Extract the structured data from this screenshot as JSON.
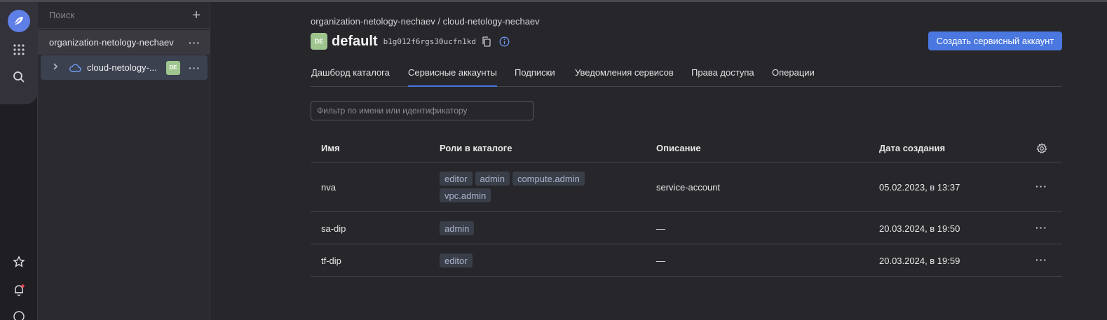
{
  "sidebar": {
    "search_placeholder": "Поиск",
    "add_icon": "plus-icon",
    "organization": "organization-netology-nechaev",
    "cloud": {
      "label": "cloud-netology-...",
      "badge": "DE"
    },
    "menu_glyph": "···"
  },
  "header": {
    "breadcrumb": "organization-netology-nechaev / cloud-netology-nechaev",
    "badge": "DE",
    "title": "default",
    "folder_id": "b1g012f6rgs30ucfn1kd",
    "create_button": "Создать сервисный аккаунт"
  },
  "tabs": [
    {
      "label": "Дашборд каталога"
    },
    {
      "label": "Сервисные аккаунты",
      "active": true
    },
    {
      "label": "Подписки"
    },
    {
      "label": "Уведомления сервисов"
    },
    {
      "label": "Права доступа"
    },
    {
      "label": "Операции"
    }
  ],
  "filter": {
    "placeholder": "Фильтр по имени или идентификатору",
    "value": ""
  },
  "table": {
    "columns": [
      "Имя",
      "Роли в каталоге",
      "Описание",
      "Дата создания"
    ],
    "rows": [
      {
        "name": "nva",
        "roles": [
          "editor",
          "admin",
          "compute.admin",
          "vpc.admin"
        ],
        "description": "service-account",
        "created": "05.02.2023, в 13:37"
      },
      {
        "name": "sa-dip",
        "roles": [
          "admin"
        ],
        "description": "—",
        "created": "20.03.2024, в 19:50"
      },
      {
        "name": "tf-dip",
        "roles": [
          "editor"
        ],
        "description": "—",
        "created": "20.03.2024, в 19:59"
      }
    ]
  },
  "colors": {
    "accent": "#4a77e0",
    "badge": "#9fc58f",
    "notification": "#e5484d"
  }
}
